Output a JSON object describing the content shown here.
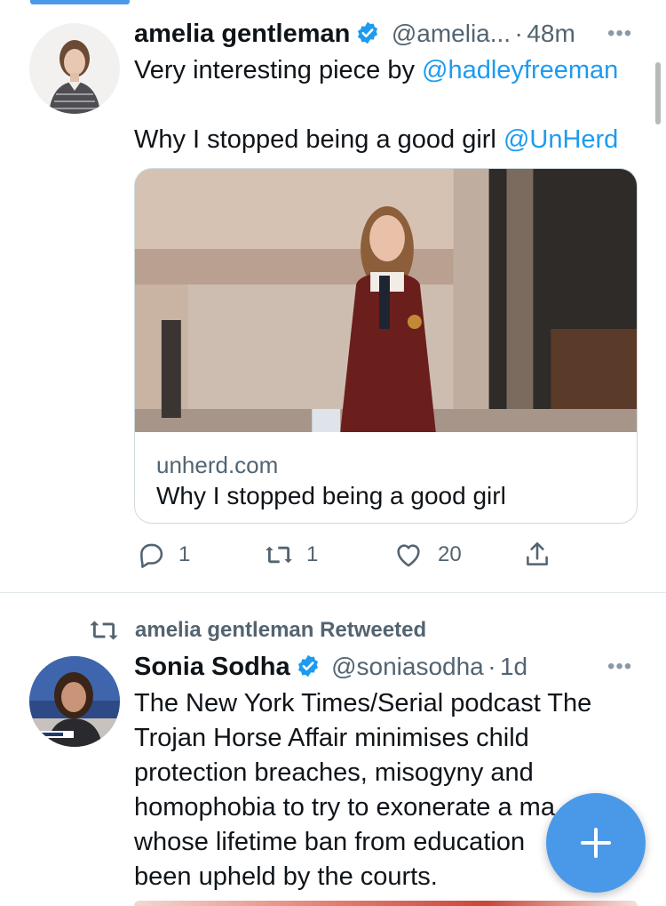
{
  "tweet1": {
    "author_name": "amelia gentleman",
    "handle": "@amelia...",
    "separator": "·",
    "time": "48m",
    "text_line1_prefix": "Very interesting piece by ",
    "text_line1_mention": "@hadleyfreeman",
    "text_line2_prefix": "Why I stopped being a good girl ",
    "text_line2_mention": "@UnHerd",
    "card": {
      "domain": "unherd.com",
      "title": "Why I stopped being a good girl"
    },
    "actions": {
      "reply_count": "1",
      "retweet_count": "1",
      "like_count": "20"
    }
  },
  "tweet2": {
    "retweeted_by": "amelia gentleman Retweeted",
    "author_name": "Sonia Sodha",
    "handle": "@soniasodha",
    "separator": "·",
    "time": "1d",
    "text_lines": [
      "The New York Times/Serial podcast The",
      "Trojan Horse Affair minimises child",
      "protection breaches, misogyny and",
      "homophobia to try to exonerate a ma",
      "whose lifetime ban from education",
      "been upheld by the courts."
    ]
  },
  "icons": {
    "more": "more-icon",
    "verified": "verified-badge-icon",
    "reply": "reply-icon",
    "retweet": "retweet-icon",
    "like": "heart-icon",
    "share": "share-icon",
    "compose": "plus-icon"
  },
  "colors": {
    "accent": "#1d9bf0",
    "fab": "#4a99e9",
    "secondary_text": "#536471"
  }
}
